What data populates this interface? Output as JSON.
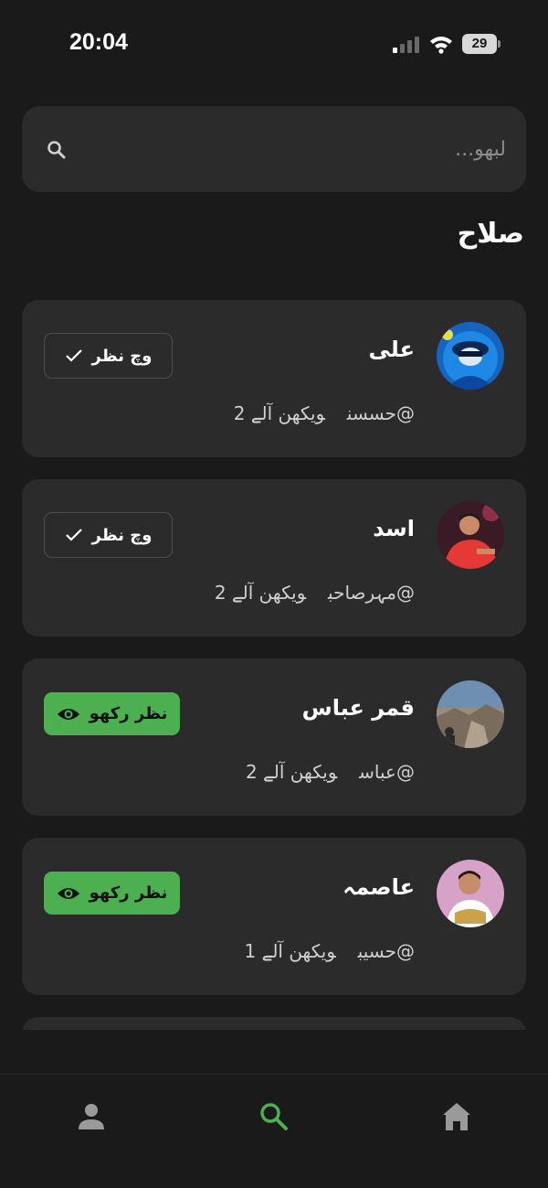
{
  "status_bar": {
    "time": "20:04",
    "battery": "29"
  },
  "search": {
    "placeholder": "لبھو..."
  },
  "section": {
    "title": "صلاح"
  },
  "labels": {
    "following": "وچ نظر",
    "follow": "نظر رکھو",
    "viewers_prefix": "ویکھن آلے"
  },
  "users": [
    {
      "name": "علی",
      "handle": "@حسسن",
      "viewers": "2",
      "status": "following",
      "avatar": "blue-masked-figure"
    },
    {
      "name": "اسد",
      "handle": "@مہرصاحب",
      "viewers": "2",
      "status": "following",
      "avatar": "man-red-shirt"
    },
    {
      "name": "قمر عباس",
      "handle": "@عباس",
      "viewers": "2",
      "status": "follow",
      "avatar": "desert-landscape"
    },
    {
      "name": "عاصمہ",
      "handle": "@حسیب",
      "viewers": "1",
      "status": "follow",
      "avatar": "child-pink-background"
    }
  ],
  "colors": {
    "accent": "#4caf50",
    "background": "#1a1a1a",
    "card": "#2b2b2b"
  },
  "nav": {
    "items": [
      "person-icon",
      "search-icon",
      "home-icon"
    ],
    "active": "search-icon"
  }
}
